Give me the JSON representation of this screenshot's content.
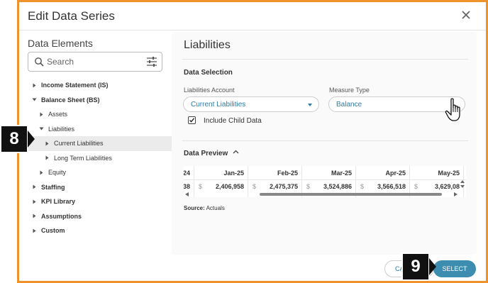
{
  "dialog": {
    "title": "Edit Data Series"
  },
  "left_panel": {
    "heading": "Data Elements",
    "search_placeholder": "Search",
    "tree": [
      {
        "label": "Income Statement (IS)",
        "level": 0,
        "state": "collapsed",
        "bold": true
      },
      {
        "label": "Balance Sheet (BS)",
        "level": 0,
        "state": "expanded",
        "bold": true
      },
      {
        "label": "Assets",
        "level": 1,
        "state": "collapsed",
        "bold": false
      },
      {
        "label": "Liabilities",
        "level": 1,
        "state": "expanded",
        "bold": false
      },
      {
        "label": "Current Liabilities",
        "level": 2,
        "state": "collapsed",
        "bold": false,
        "selected": true
      },
      {
        "label": "Long Term Liabilities",
        "level": 2,
        "state": "collapsed",
        "bold": false
      },
      {
        "label": "Equity",
        "level": 1,
        "state": "collapsed",
        "bold": false
      },
      {
        "label": "Staffing",
        "level": 0,
        "state": "collapsed",
        "bold": true
      },
      {
        "label": "KPI Library",
        "level": 0,
        "state": "collapsed",
        "bold": true
      },
      {
        "label": "Assumptions",
        "level": 0,
        "state": "collapsed",
        "bold": true
      },
      {
        "label": "Custom",
        "level": 0,
        "state": "collapsed",
        "bold": true
      }
    ]
  },
  "right_panel": {
    "title": "Liabilities",
    "data_selection_heading": "Data Selection",
    "account_label": "Liabilities Account",
    "account_value": "Current Liabilities",
    "measure_label": "Measure Type",
    "measure_value": "Balance",
    "include_child_label": "Include Child Data",
    "include_child_checked": true,
    "preview_heading": "Data Preview",
    "preview": {
      "partial_first_header": "24",
      "partial_first_value": "38",
      "columns": [
        {
          "header": "Jan-25",
          "currency": "$",
          "value": "2,406,958"
        },
        {
          "header": "Feb-25",
          "currency": "$",
          "value": "2,475,375"
        },
        {
          "header": "Mar-25",
          "currency": "$",
          "value": "3,524,886"
        },
        {
          "header": "Apr-25",
          "currency": "$",
          "value": "3,566,518"
        },
        {
          "header": "May-25",
          "currency": "$",
          "value": "3,629,08"
        }
      ]
    },
    "source_label": "Source:",
    "source_value": "Actuals"
  },
  "footer": {
    "cancel_label": "CA",
    "select_label": "SELECT"
  },
  "callouts": {
    "left": "8",
    "right": "9"
  },
  "colors": {
    "frame": "#f0922b",
    "accent": "#2a7da8",
    "select_button": "#3c8daf",
    "selected_row": "#ebebeb"
  }
}
